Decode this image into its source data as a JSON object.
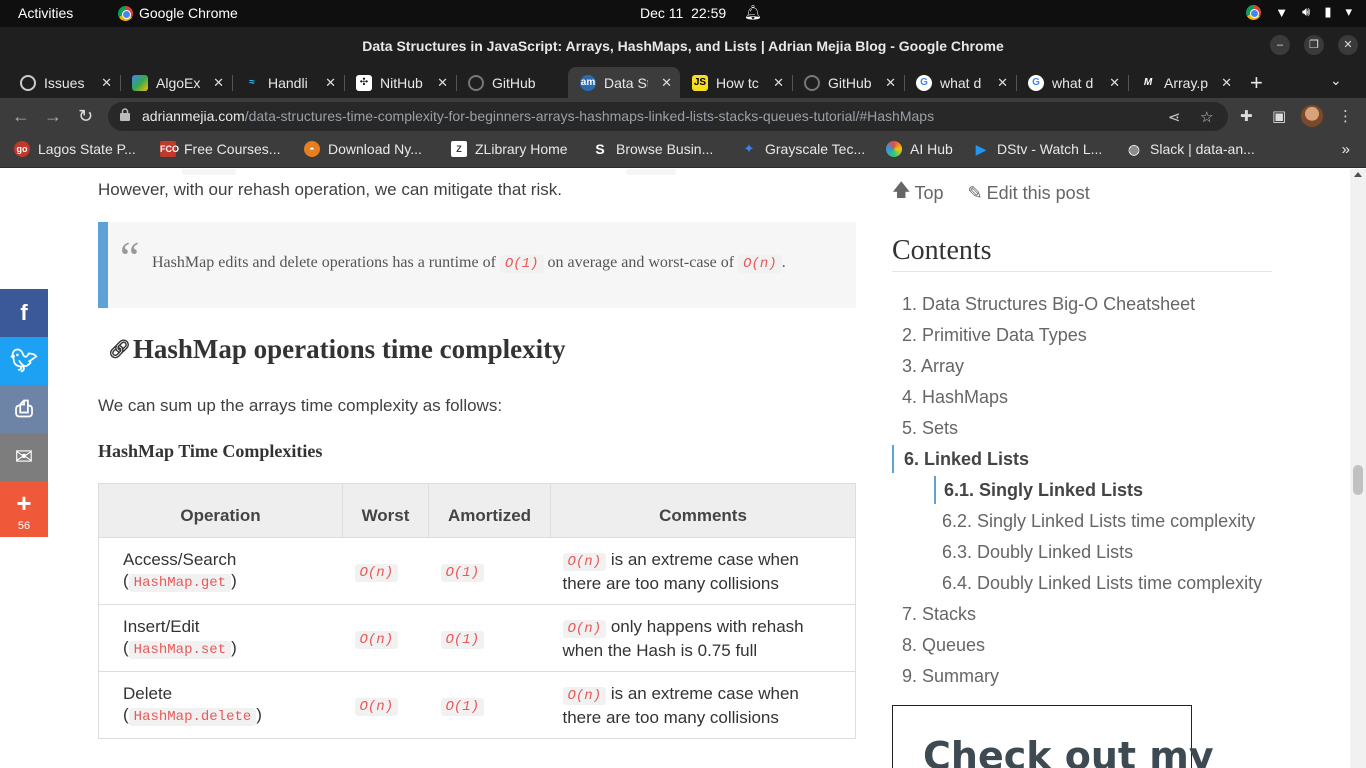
{
  "os": {
    "activities": "Activities",
    "app_name": "Google Chrome",
    "date": "Dec 11",
    "time": "22:59"
  },
  "window": {
    "title": "Data Structures in JavaScript: Arrays, HashMaps, and Lists | Adrian Mejia Blog - Google Chrome"
  },
  "tabs": [
    {
      "label": "Issues",
      "icon": "github-icon"
    },
    {
      "label": "AlgoEx",
      "icon": "algoexpert-icon"
    },
    {
      "label": "Handli",
      "icon": "tailwind-icon"
    },
    {
      "label": "NitHub",
      "icon": "nithub-icon"
    },
    {
      "label": "GitHub",
      "icon": "github-icon"
    },
    {
      "label": "Data St",
      "icon": "adrian-mejia-icon",
      "active": true
    },
    {
      "label": "How tc",
      "icon": "javascript-icon"
    },
    {
      "label": "GitHub",
      "icon": "github-icon"
    },
    {
      "label": "what d",
      "icon": "google-icon"
    },
    {
      "label": "what d",
      "icon": "google-icon"
    },
    {
      "label": "Array.p",
      "icon": "mdn-icon"
    }
  ],
  "url": {
    "domain": "adrianmejia.com",
    "path": "/data-structures-time-complexity-for-beginners-arrays-hashmaps-linked-lists-stacks-queues-tutorial/#HashMaps"
  },
  "bookmarks": [
    {
      "label": "Lagos State P...",
      "icon": "go-icon"
    },
    {
      "label": "Free Courses...",
      "icon": "fco-icon"
    },
    {
      "label": "Download Ny...",
      "icon": "download-icon"
    },
    {
      "label": "ZLibrary Home",
      "icon": "zlibrary-icon"
    },
    {
      "label": "Browse Busin...",
      "icon": "s-icon"
    },
    {
      "label": "Grayscale Tec...",
      "icon": "grayscale-icon"
    },
    {
      "label": "AI Hub",
      "icon": "ai-hub-icon"
    },
    {
      "label": "DStv - Watch L...",
      "icon": "dstv-icon"
    },
    {
      "label": "Slack | data-an...",
      "icon": "slack-icon"
    }
  ],
  "article": {
    "para_top": "However, with our rehash operation, we can mitigate that risk.",
    "quote": {
      "before": "HashMap edits and delete operations has a runtime of",
      "code1": "O(1)",
      "middle": "on average and worst-case of",
      "code2": "O(n)",
      "after": "."
    },
    "heading": "HashMap operations time complexity",
    "para2": "We can sum up the arrays time complexity as follows:",
    "table_caption": "HashMap Time Complexities",
    "table": {
      "headers": [
        "Operation",
        "Worst",
        "Amortized",
        "Comments"
      ],
      "rows": [
        {
          "op": "Access/Search",
          "op_code": "HashMap.get",
          "worst": "O(n)",
          "amortized": "O(1)",
          "comment_code": "O(n)",
          "comment_l1": "is an extreme case when",
          "comment_l2": "there are too many collisions"
        },
        {
          "op": "Insert/Edit",
          "op_code": "HashMap.set",
          "worst": "O(n)",
          "amortized": "O(1)",
          "comment_code": "O(n)",
          "comment_l1": "only happens with rehash",
          "comment_l2": "when the Hash is 0.75 full"
        },
        {
          "op": "Delete",
          "op_code": "HashMap.delete",
          "worst": "O(n)",
          "amortized": "O(1)",
          "comment_code": "O(n)",
          "comment_l1": "is an extreme case when",
          "comment_l2": "there are too many collisions"
        }
      ]
    }
  },
  "share": {
    "count": "56",
    "colors": {
      "facebook": "#3b5998",
      "twitter": "#1da1f2",
      "print": "#6d84a6",
      "email": "#7d7d7d",
      "more": "#f0583a"
    }
  },
  "sidebar": {
    "top_link": "Top",
    "edit_link": "Edit this post",
    "contents_title": "Contents",
    "toc": [
      "1. Data Structures Big-O Cheatsheet",
      "2. Primitive Data Types",
      "3. Array",
      "4. HashMaps",
      "5. Sets",
      "6. Linked Lists",
      "6.1. Singly Linked Lists",
      "6.2. Singly Linked Lists time complexity",
      "6.3. Doubly Linked Lists",
      "6.4. Doubly Linked Lists time complexity",
      "7. Stacks",
      "8. Queues",
      "9. Summary"
    ],
    "promo": "Check out my"
  }
}
